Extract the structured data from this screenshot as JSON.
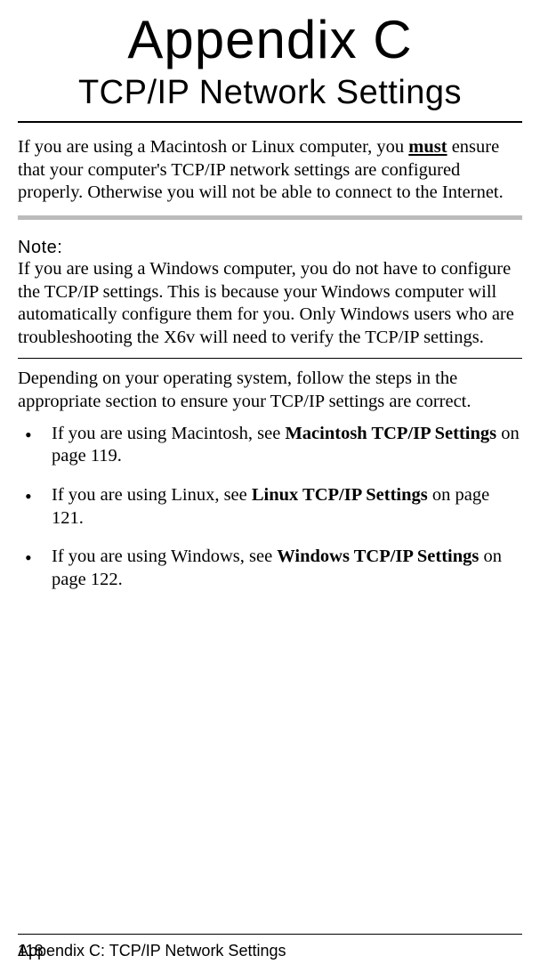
{
  "heading": {
    "appendix": "Appendix C",
    "title": "TCP/IP Network Settings"
  },
  "intro": {
    "prefix": "If you are using a Macintosh or Linux computer, you ",
    "must": "must",
    "suffix": " ensure that your computer's TCP/IP network settings are configured properly. Otherwise you will not be able to connect to the Internet."
  },
  "note": {
    "label": "Note:",
    "body": "If you are using a Windows computer, you do not have to configure the TCP/IP settings. This is because your Windows computer will automatically configure them for you. Only Windows users who are troubleshooting the X6v will need to verify the TCP/IP settings."
  },
  "depending": "Depending on your operating system, follow the steps in the appropriate section to ensure your TCP/IP settings are correct.",
  "bullets": [
    {
      "prefix": "If you are using Macintosh, see ",
      "bold": "Macintosh TCP/IP Settings",
      "suffix": " on page 119."
    },
    {
      "prefix": "If you are using Linux, see ",
      "bold": "Linux TCP/IP Settings",
      "suffix": " on page 121."
    },
    {
      "prefix": "If you are using Windows, see ",
      "bold": "Windows TCP/IP Settings",
      "suffix": " on page 122."
    }
  ],
  "footer": {
    "text": "Appendix C: TCP/IP Network Settings",
    "page_number": "118"
  }
}
